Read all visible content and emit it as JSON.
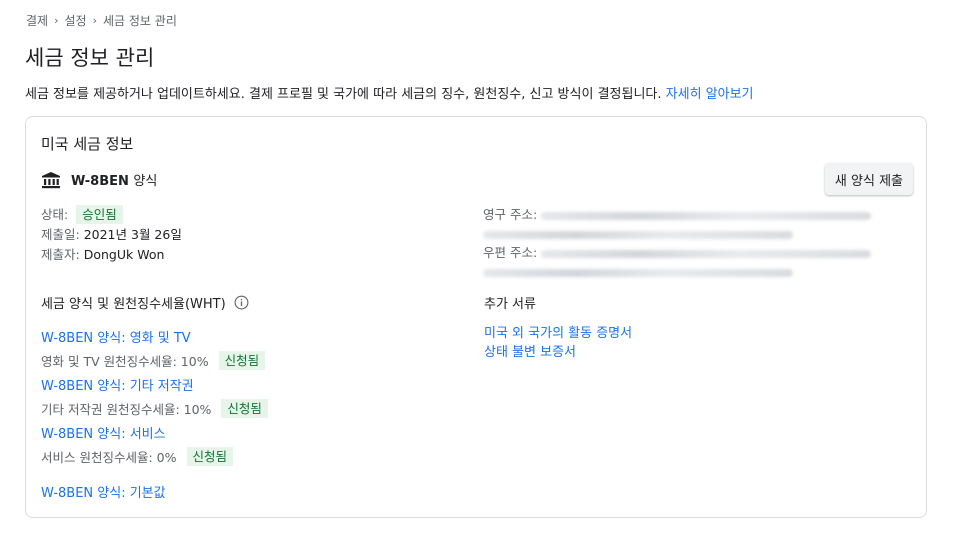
{
  "breadcrumb": {
    "items": [
      "결제",
      "설정",
      "세금 정보 관리"
    ],
    "separator": "›"
  },
  "page": {
    "title": "세금 정보 관리",
    "description": "세금 정보를 제공하거나 업데이트하세요. 결제 프로필 및 국가에 따라 세금의 징수, 원천징수, 신고 방식이 결정됩니다.",
    "learn_more": "자세히 알아보기"
  },
  "card": {
    "title": "미국 세금 정보",
    "form_icon": "bank-icon",
    "form_code": "W-8BEN",
    "form_suffix": "양식",
    "submit_button": "새 양식 제출",
    "status_label": "상태:",
    "status_value": "승인됨",
    "submitted_label": "제출일:",
    "submitted_value": "2021년 3월 26일",
    "submitter_label": "제출자:",
    "submitter_value": "DongUk Won",
    "permanent_address_label": "영구 주소:",
    "mailing_address_label": "우편 주소:",
    "wht_heading": "세금 양식 및 원천징수세율(WHT)",
    "info_icon": "info-icon",
    "wht_items": [
      {
        "form_link": "W-8BEN 양식: 영화 및 TV",
        "rate_text": "영화 및 TV 원천징수세율: 10%",
        "badge": "신청됨"
      },
      {
        "form_link": "W-8BEN 양식: 기타 저작권",
        "rate_text": "기타 저작권 원천징수세율: 10%",
        "badge": "신청됨"
      },
      {
        "form_link": "W-8BEN 양식: 서비스",
        "rate_text": "서비스 원천징수세율: 0%",
        "badge": "신청됨"
      }
    ],
    "default_form_link": "W-8BEN 양식: 기본값",
    "docs_heading": "추가 서류",
    "docs": [
      "미국 외 국가의 활동 증명서",
      "상태 불변 보증서"
    ]
  },
  "colors": {
    "link": "#1a73e8",
    "badge_bg": "#e6f4ea",
    "badge_text": "#137333",
    "secondary_text": "#5f6368"
  }
}
